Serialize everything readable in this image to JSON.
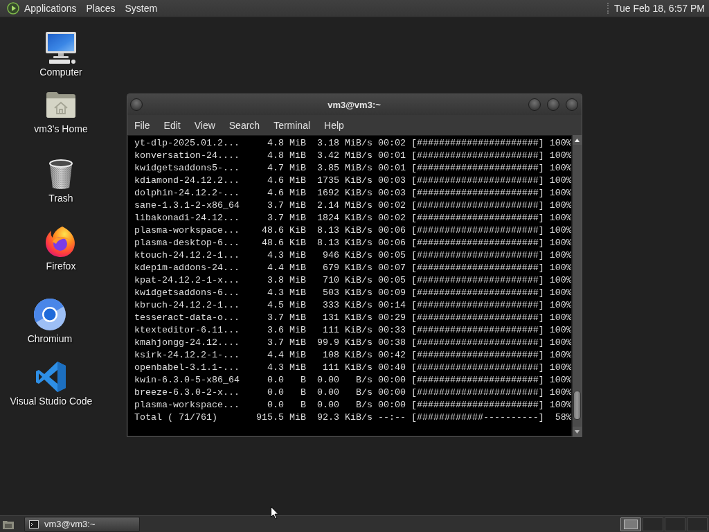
{
  "top_panel": {
    "menus": [
      "Applications",
      "Places",
      "System"
    ],
    "clock": "Tue Feb 18, 6:57 PM"
  },
  "desktop_icons": [
    {
      "kind": "computer",
      "label": "Computer"
    },
    {
      "kind": "home",
      "label": "vm3's Home"
    },
    {
      "kind": "trash",
      "label": "Trash"
    },
    {
      "kind": "firefox",
      "label": "Firefox"
    },
    {
      "kind": "chromium",
      "label": "Chromium"
    },
    {
      "kind": "vscode",
      "label": "Visual Studio Code"
    }
  ],
  "terminal_window": {
    "title": "vm3@vm3:~",
    "menu": [
      "File",
      "Edit",
      "View",
      "Search",
      "Terminal",
      "Help"
    ],
    "lines": [
      "yt-dlp-2025.01.2...     4.8 MiB  3.18 MiB/s 00:02 [######################] 100%",
      "konversation-24....     4.8 MiB  3.42 MiB/s 00:01 [######################] 100%",
      "kwidgetsaddons5-...     4.7 MiB  3.85 MiB/s 00:01 [######################] 100%",
      "kdiamond-24.12.2...     4.6 MiB  1735 KiB/s 00:03 [######################] 100%",
      "dolphin-24.12.2-...     4.6 MiB  1692 KiB/s 00:03 [######################] 100%",
      "sane-1.3.1-2-x86_64     3.7 MiB  2.14 MiB/s 00:02 [######################] 100%",
      "libakonadi-24.12...     3.7 MiB  1824 KiB/s 00:02 [######################] 100%",
      "plasma-workspace...    48.6 KiB  8.13 KiB/s 00:06 [######################] 100%",
      "plasma-desktop-6...    48.6 KiB  8.13 KiB/s 00:06 [######################] 100%",
      "ktouch-24.12.2-1...     4.3 MiB   946 KiB/s 00:05 [######################] 100%",
      "kdepim-addons-24...     4.4 MiB   679 KiB/s 00:07 [######################] 100%",
      "kpat-24.12.2-1-x...     3.8 MiB   710 KiB/s 00:05 [######################] 100%",
      "kwidgetsaddons-6...     4.3 MiB   503 KiB/s 00:09 [######################] 100%",
      "kbruch-24.12.2-1...     4.5 MiB   333 KiB/s 00:14 [######################] 100%",
      "tesseract-data-o...     3.7 MiB   131 KiB/s 00:29 [######################] 100%",
      "ktexteditor-6.11...     3.6 MiB   111 KiB/s 00:33 [######################] 100%",
      "kmahjongg-24.12....     3.7 MiB  99.9 KiB/s 00:38 [######################] 100%",
      "ksirk-24.12.2-1-...     4.4 MiB   108 KiB/s 00:42 [######################] 100%",
      "openbabel-3.1.1-...     4.3 MiB   111 KiB/s 00:40 [######################] 100%",
      "kwin-6.3.0-5-x86_64     0.0   B  0.00   B/s 00:00 [######################] 100%",
      "breeze-6.3.0-2-x...     0.0   B  0.00   B/s 00:00 [######################] 100%",
      "plasma-workspace...     0.0   B  0.00   B/s 00:00 [######################] 100%",
      "Total ( 71/761)       915.5 MiB  92.3 KiB/s --:-- [############----------]  58%"
    ]
  },
  "taskbar": {
    "windows": [
      {
        "title": "vm3@vm3:~",
        "selected": true
      }
    ],
    "workspaces": [
      {
        "selected": true
      },
      {
        "selected": false
      },
      {
        "selected": false
      },
      {
        "selected": false
      }
    ]
  }
}
